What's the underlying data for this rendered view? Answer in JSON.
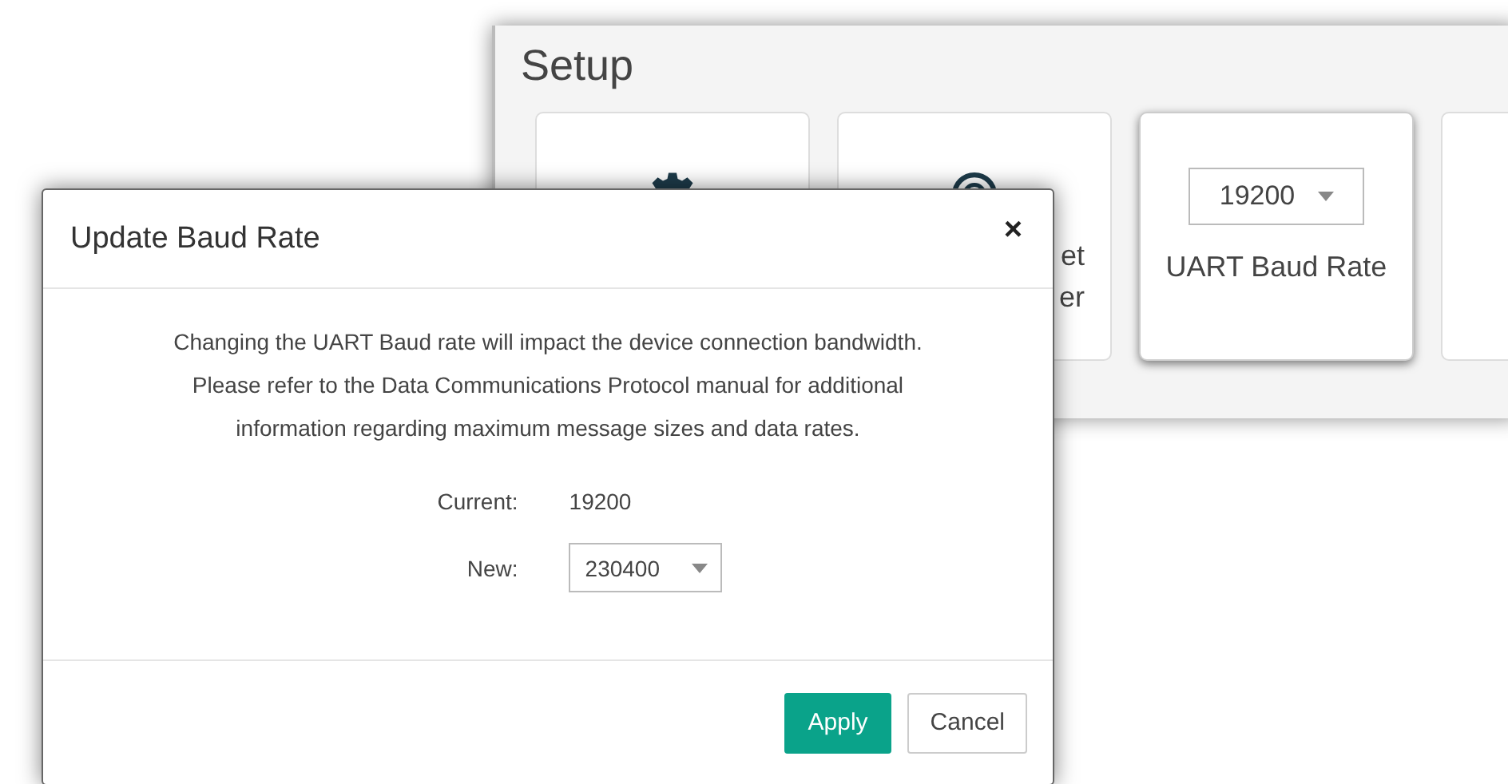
{
  "setup": {
    "title": "Setup",
    "cards": [
      {
        "kind": "gear",
        "selected": false
      },
      {
        "kind": "target",
        "selected": false,
        "label_lines": [
          "et",
          "er"
        ]
      },
      {
        "kind": "select",
        "selected": true,
        "value": "19200",
        "label": "UART Baud Rate"
      },
      {
        "kind": "blank",
        "selected": false
      }
    ]
  },
  "dialog": {
    "title": "Update Baud Rate",
    "close": "×",
    "message_lines": [
      "Changing the UART Baud rate will impact the device connection bandwidth.",
      "Please refer to the Data Communications Protocol manual for additional",
      "information regarding maximum message sizes and data rates."
    ],
    "current": {
      "label": "Current:",
      "value": "19200"
    },
    "new": {
      "label": "New:",
      "value": "230400"
    },
    "buttons": [
      {
        "label": "Apply",
        "kind": "primary"
      },
      {
        "label": "Cancel",
        "kind": "secondary"
      }
    ]
  }
}
